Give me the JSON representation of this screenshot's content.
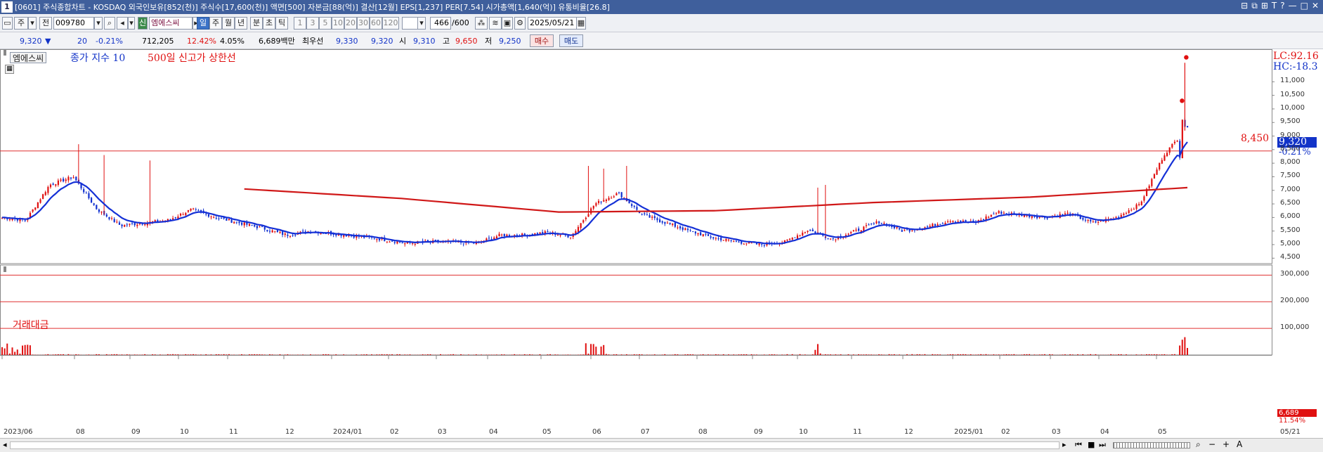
{
  "window": {
    "num": "1",
    "title": "[0601] 주식종합차트 - KOSDAQ 외국인보유[852(천)] 주식수[17,600(천)] 액면[500] 자본금[88(억)] 결산[12월] EPS[1,237] PER[7.54] 시가총액[1,640(억)] 유통비율[26.8]",
    "buttons": [
      "⊟",
      "⧉",
      "⊞",
      "T",
      "?",
      "—",
      "□",
      "✕"
    ]
  },
  "toolbar": {
    "code_prefix": "주",
    "jeon_label": "전",
    "code": "009780",
    "sin_label": "신",
    "stock_name": "엠에스씨",
    "periods": [
      "일",
      "주",
      "월",
      "년",
      "분",
      "초",
      "틱"
    ],
    "selected_period": "일",
    "intervals": [
      "1",
      "3",
      "5",
      "10",
      "20",
      "30",
      "60",
      "120"
    ],
    "count": "466",
    "count_total": "/600",
    "date": "2025/05/21"
  },
  "quote": {
    "price": "9,320",
    "arrow": "▼",
    "change": "20",
    "change_pct": "-0.21%",
    "volume": "712,205",
    "turnover_pct": "12.42%",
    "other_pct": "4.05%",
    "amount": "6,689백만",
    "best_bid_label": "최우선",
    "ask": "9,330",
    "bid": "9,320",
    "open_label": "시",
    "open": "9,310",
    "high_label": "고",
    "high": "9,650",
    "low_label": "저",
    "low": "9,250",
    "buy_button": "매수",
    "sell_button": "매도"
  },
  "price_panel": {
    "stock_tab": "엠에스씨",
    "indicator1": "종가 지수 10",
    "indicator2": "500일 신고가 상한선",
    "lc_label": "LC:92.16",
    "hc_label": "HC:-18.3",
    "current_price": "9,320",
    "current_change": "-0.21%",
    "hline_label": "8,450",
    "hline_value": 8450,
    "y_ticks": [
      "11,000",
      "10,500",
      "10,000",
      "9,500",
      "9,000",
      "8,500",
      "8,000",
      "7,500",
      "7,000",
      "6,500",
      "6,000",
      "5,500",
      "5,000",
      "4,500"
    ]
  },
  "volume_panel": {
    "title": "거래대금",
    "y_ticks": [
      "300,000",
      "200,000",
      "100,000"
    ],
    "current_value": "6,689",
    "current_pct": "11.54%"
  },
  "x_axis": {
    "labels": [
      "2023/06",
      "08",
      "09",
      "10",
      "11",
      "12",
      "2024/01",
      "02",
      "03",
      "04",
      "05",
      "06",
      "07",
      "08",
      "09",
      "10",
      "11",
      "12",
      "2025/01",
      "02",
      "03",
      "04",
      "05",
      "05/21"
    ]
  },
  "colors": {
    "up": "#e01010",
    "down": "#1030d0",
    "ma": "#1430d6",
    "upper_limit": "#d01818",
    "hline": "#e03030",
    "titlebar": "#3f5f9c"
  },
  "chart_data": {
    "type": "candlestick",
    "close_series_anchors": [
      [
        "2023/06",
        6000
      ],
      [
        "2023/06",
        5900
      ],
      [
        "2023/06",
        7200
      ],
      [
        "2023/06",
        7500
      ],
      [
        "2023/07",
        6300
      ],
      [
        "2023/07",
        5700
      ],
      [
        "2023/08",
        5800
      ],
      [
        "2023/08",
        5900
      ],
      [
        "2023/09",
        6300
      ],
      [
        "2023/09",
        6000
      ],
      [
        "2023/10",
        5800
      ],
      [
        "2023/10",
        5600
      ],
      [
        "2023/11",
        5350
      ],
      [
        "2023/11",
        5500
      ],
      [
        "2023/12",
        5400
      ],
      [
        "2023/12",
        5300
      ],
      [
        "2024/01",
        5200
      ],
      [
        "2024/01",
        5050
      ],
      [
        "2024/02",
        5100
      ],
      [
        "2024/03",
        5100
      ],
      [
        "2024/03",
        5050
      ],
      [
        "2024/04",
        5350
      ],
      [
        "2024/05",
        5350
      ],
      [
        "2024/05",
        5450
      ],
      [
        "2024/06",
        5300
      ],
      [
        "2024/06",
        6500
      ],
      [
        "2024/06",
        6900
      ],
      [
        "2024/07",
        6100
      ],
      [
        "2024/07",
        5800
      ],
      [
        "2024/08",
        5500
      ],
      [
        "2024/08",
        5250
      ],
      [
        "2024/09",
        5100
      ],
      [
        "2024/09",
        5000
      ],
      [
        "2024/10",
        5100
      ],
      [
        "2024/10",
        5550
      ],
      [
        "2024/10",
        5200
      ],
      [
        "2024/11",
        5500
      ],
      [
        "2024/11",
        5850
      ],
      [
        "2024/12",
        5500
      ],
      [
        "2024/12",
        5650
      ],
      [
        "2025/01",
        5900
      ],
      [
        "2025/01",
        5800
      ],
      [
        "2025/02",
        6200
      ],
      [
        "2025/02",
        6100
      ],
      [
        "2025/03",
        6000
      ],
      [
        "2025/03",
        6150
      ],
      [
        "2025/04",
        5800
      ],
      [
        "2025/04",
        6000
      ],
      [
        "2025/05",
        6500
      ],
      [
        "2025/05",
        8300
      ],
      [
        "2025/05",
        9320
      ]
    ],
    "ma10_label": "종가 지수 10",
    "upper_limit_500d": [
      [
        7050
      ],
      [
        6700
      ],
      [
        6200
      ],
      [
        6250
      ],
      [
        6550
      ],
      [
        6750
      ],
      [
        7100
      ]
    ],
    "horizontal_line": 8450,
    "high_marks": [
      11900,
      10300
    ],
    "y_range": [
      4300,
      12200
    ],
    "volume_y_range": [
      0,
      330000
    ],
    "last_volume": 6689
  }
}
